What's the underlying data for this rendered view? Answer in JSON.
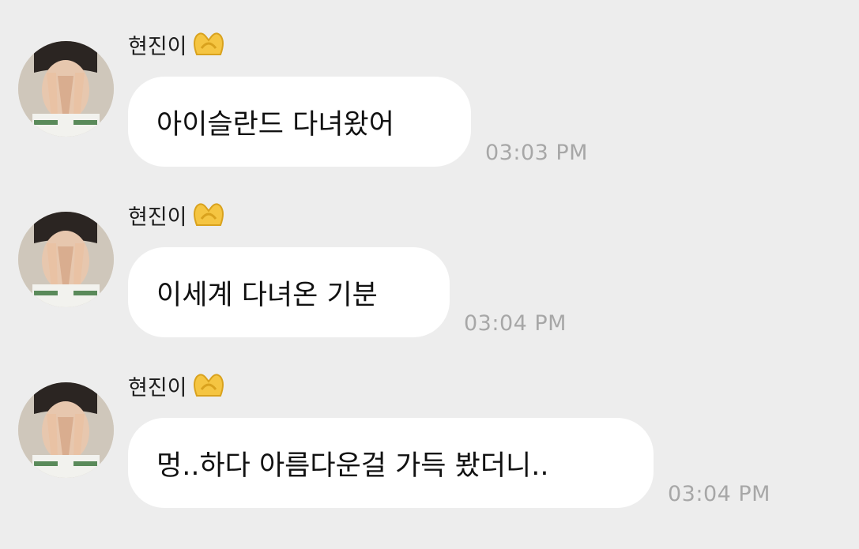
{
  "conversation": {
    "messages": [
      {
        "sender": "현진이",
        "sender_emoji": "heart-hands-emoji",
        "text": "아이슬란드 다녀왔어",
        "time": "03:03 PM"
      },
      {
        "sender": "현진이",
        "sender_emoji": "heart-hands-emoji",
        "text": "이세계 다녀온 기분",
        "time": "03:04 PM"
      },
      {
        "sender": "현진이",
        "sender_emoji": "heart-hands-emoji",
        "text": "멍..하다 아름다운걸 가득 봤더니..",
        "time": "03:04 PM"
      }
    ]
  },
  "colors": {
    "background": "#ededed",
    "bubble": "#ffffff",
    "timestamp": "#a7a7a7",
    "text": "#111111"
  }
}
